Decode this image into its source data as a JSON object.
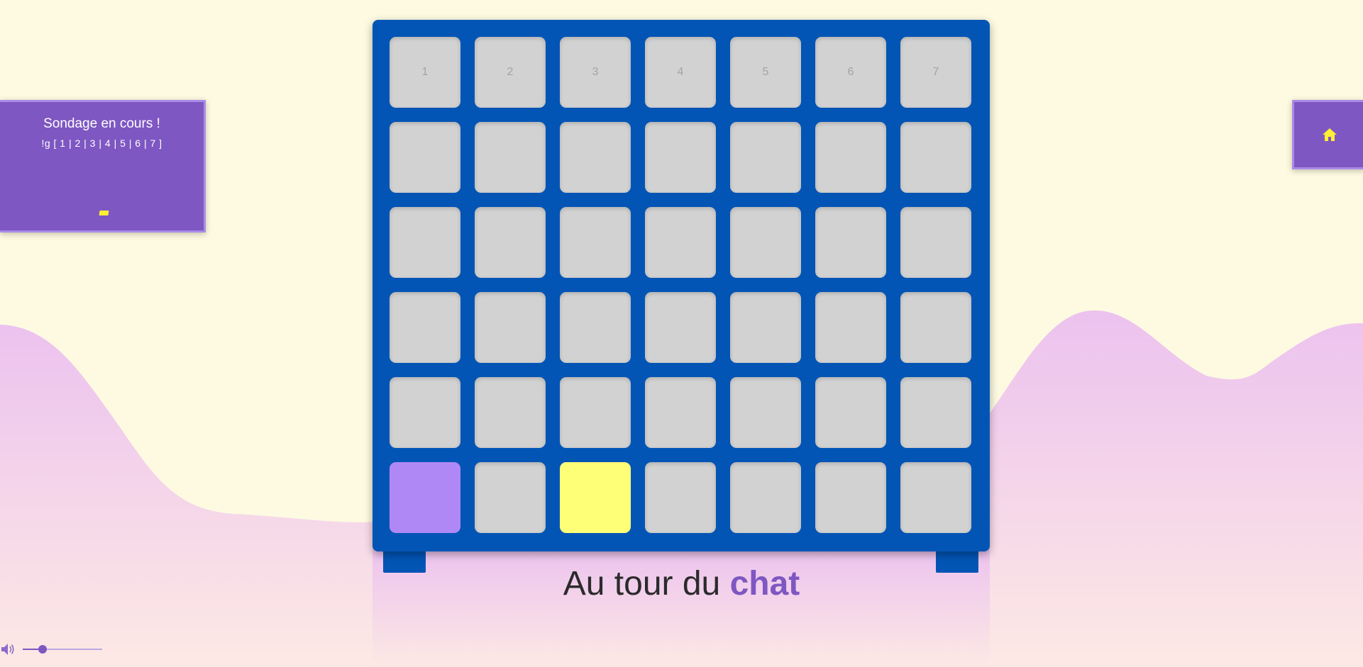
{
  "poll": {
    "title": "Sondage en cours !",
    "options": "!g [ 1 | 2 | 3 | 4 | 5 | 6 | 7 ]"
  },
  "home": {
    "icon": "home-icon"
  },
  "board": {
    "columns": [
      "1",
      "2",
      "3",
      "4",
      "5",
      "6",
      "7"
    ],
    "rows": 6,
    "tokens": [
      {
        "row": 6,
        "col": 1,
        "player": "purple"
      },
      {
        "row": 6,
        "col": 3,
        "player": "yellow"
      }
    ]
  },
  "status": {
    "prefix": "Au tour du",
    "player": "chat"
  },
  "volume": {
    "icon": "speaker-icon",
    "level": 0.25
  },
  "colors": {
    "background": "#fdfae1",
    "board": "#0355b5",
    "cell_empty": "#d2d2d2",
    "token_purple": "#b088f5",
    "token_yellow": "#ffff77",
    "accent": "#7e57c2",
    "home_icon": "#ffee33"
  }
}
